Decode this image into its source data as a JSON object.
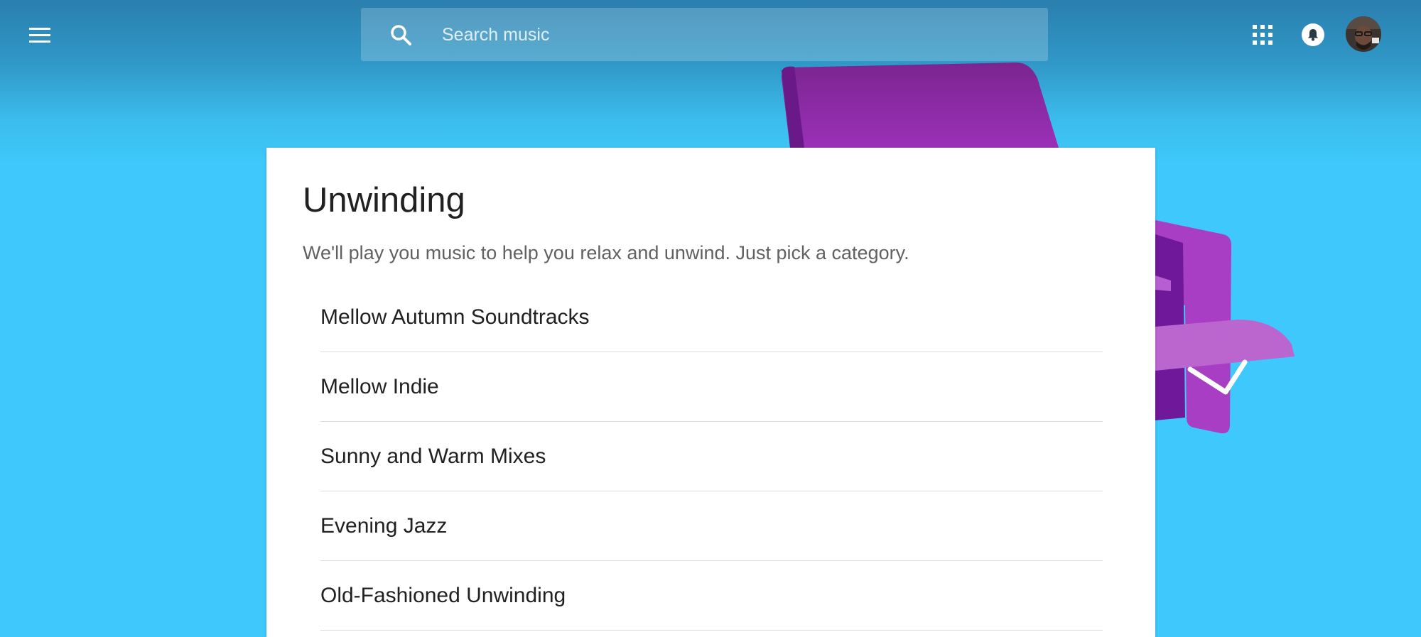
{
  "header": {
    "menu_icon": "hamburger-menu-icon",
    "search": {
      "icon": "search-icon",
      "placeholder": "Search music",
      "value": ""
    },
    "apps_icon": "apps-grid-icon",
    "notifications_icon": "bell-icon",
    "avatar": "user-avatar"
  },
  "main": {
    "title": "Unwinding",
    "description": "We'll play you music to help you relax and unwind. Just pick a category.",
    "categories": [
      {
        "label": "Mellow Autumn Soundtracks"
      },
      {
        "label": "Mellow Indie"
      },
      {
        "label": "Sunny and Warm Mixes"
      },
      {
        "label": "Evening Jazz"
      },
      {
        "label": "Old-Fashioned Unwinding"
      }
    ]
  },
  "colors": {
    "background_top": "#2a7fae",
    "background": "#3ec8fb",
    "card": "#ffffff",
    "illustration_purple": "#9c27b0"
  }
}
